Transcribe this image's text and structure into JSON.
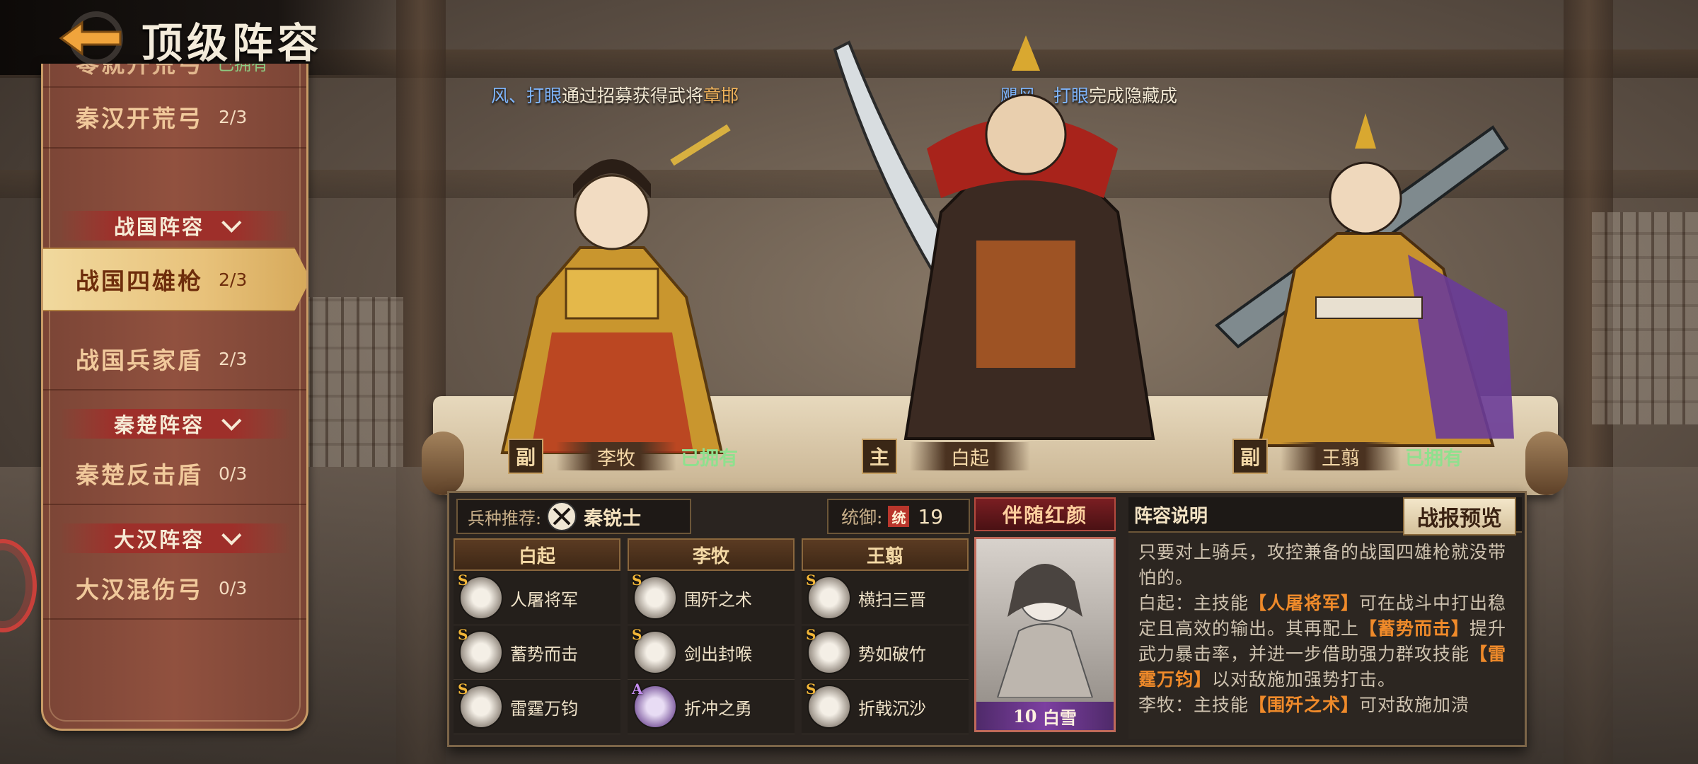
{
  "header": {
    "title": "顶级阵容"
  },
  "sidebar": {
    "partial_item": {
      "name": "零就开荒弓",
      "owned": "已拥有"
    },
    "items": [
      {
        "name": "秦汉开荒弓",
        "count": "2/3"
      },
      {
        "group": "战国阵容"
      },
      {
        "name": "战国四雄枪",
        "count": "2/3",
        "selected": true
      },
      {
        "name": "战国兵家盾",
        "count": "2/3"
      },
      {
        "group": "秦楚阵容"
      },
      {
        "name": "秦楚反击盾",
        "count": "0/3"
      },
      {
        "group": "大汉阵容"
      },
      {
        "name": "大汉混伤弓",
        "count": "0/3"
      }
    ]
  },
  "marquee": {
    "left": {
      "blue": "风、打眼",
      "text": "通过招募获得武将",
      "gold": "章邯"
    },
    "right": {
      "blue1": "飓风",
      "sep": "、",
      "blue2": "打眼",
      "text": "完成隐藏成"
    }
  },
  "heroes": {
    "left": {
      "role": "副",
      "name": "李牧",
      "owned": "已拥有"
    },
    "center": {
      "role": "主",
      "name": "白起"
    },
    "right": {
      "role": "副",
      "name": "王翦",
      "owned": "已拥有"
    }
  },
  "recommend": {
    "label": "兵种推荐:",
    "troop": "秦锐士",
    "troop_icon": "crossed-swords-icon"
  },
  "command": {
    "label": "统御:",
    "badge": "统",
    "value": "19"
  },
  "columns": [
    {
      "hero": "白起",
      "skills": [
        {
          "grade": "S",
          "name": "人屠将军",
          "icon": "eye-icon"
        },
        {
          "grade": "S",
          "name": "蓄势而击",
          "icon": "blade-icon"
        },
        {
          "grade": "S",
          "name": "雷霆万钧",
          "icon": "crossed-blades-icon"
        }
      ]
    },
    {
      "hero": "李牧",
      "skills": [
        {
          "grade": "S",
          "name": "围歼之术",
          "icon": "swirl-icon"
        },
        {
          "grade": "S",
          "name": "剑出封喉",
          "icon": "sword-icon"
        },
        {
          "grade": "A",
          "name": "折冲之勇",
          "icon": "crossed-blades-icon"
        }
      ]
    },
    {
      "hero": "王翦",
      "skills": [
        {
          "grade": "S",
          "name": "横扫三晋",
          "icon": "blade-icon"
        },
        {
          "grade": "S",
          "name": "势如破竹",
          "icon": "blade-icon"
        },
        {
          "grade": "S",
          "name": "折戟沉沙",
          "icon": "crossed-blades-icon"
        }
      ]
    }
  ],
  "companion": {
    "title": "伴随红颜",
    "level": "10",
    "name": "白雪"
  },
  "description": {
    "title": "阵容说明",
    "report_button": "战报预览",
    "paragraphs": [
      [
        {
          "t": "只要对上骑兵，攻控兼备的战国四雄枪就没带怕的。"
        }
      ],
      [
        {
          "t": "白起：主技能"
        },
        {
          "t": "【人屠将军】",
          "hl": true
        },
        {
          "t": "可在战斗中打出稳定且高效的输出。其再配上"
        },
        {
          "t": "【蓄势而击】",
          "hl": true
        },
        {
          "t": "提升武力暴击率，并进一步借助强力群攻技能"
        },
        {
          "t": "【雷霆万钧】",
          "hl": true
        },
        {
          "t": "以对敌施加强势打击。"
        }
      ],
      [
        {
          "t": "李牧：主技能"
        },
        {
          "t": "【围歼之术】",
          "hl": true
        },
        {
          "t": "可对敌施加溃"
        }
      ]
    ]
  },
  "colors": {
    "accent": "#ef8a2a",
    "owned": "#8fe08e",
    "panel": "#2a2420"
  }
}
